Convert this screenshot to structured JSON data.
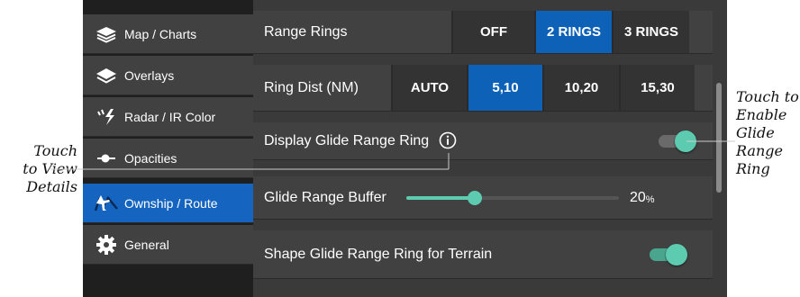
{
  "sidebar": {
    "items": [
      {
        "label": "Map / Charts",
        "icon": "layers-icon"
      },
      {
        "label": "Overlays",
        "icon": "layers-icon"
      },
      {
        "label": "Radar / IR Color",
        "icon": "lightning-icon"
      },
      {
        "label": "Opacities",
        "icon": "slider-icon"
      },
      {
        "label": "Ownship / Route",
        "icon": "ownship-route-icon",
        "active": true
      },
      {
        "label": "General",
        "icon": "gear-icon"
      }
    ]
  },
  "settings": {
    "range_rings": {
      "label": "Range Rings",
      "options": [
        "OFF",
        "2 RINGS",
        "3 RINGS"
      ],
      "selected": "2 RINGS"
    },
    "ring_dist": {
      "label": "Ring Dist (NM)",
      "options": [
        "AUTO",
        "5,10",
        "10,20",
        "15,30"
      ],
      "selected": "5,10"
    },
    "glide_range_ring": {
      "label": "Display Glide Range Ring",
      "enabled": true
    },
    "glide_buffer": {
      "label": "Glide Range Buffer",
      "value": "20",
      "unit": "%",
      "level": 0.32
    },
    "shape_terrain": {
      "label": "Shape Glide Range Ring for Terrain",
      "enabled": true
    }
  },
  "callouts": {
    "left_lines": [
      "Touch",
      "to View",
      "Details"
    ],
    "right_lines": [
      "Touch to",
      "Enable",
      "Glide",
      "Range",
      "Ring"
    ]
  },
  "colors": {
    "accent": "#0d62b8",
    "toggle": "#5ccbb0",
    "sidebar_active": "#1565c0"
  }
}
